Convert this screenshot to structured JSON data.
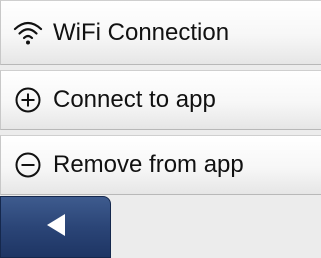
{
  "menu": {
    "items": [
      {
        "label": "WiFi Connection",
        "icon": "wifi-icon"
      },
      {
        "label": "Connect to app",
        "icon": "plus-circle-icon"
      },
      {
        "label": "Remove from app",
        "icon": "minus-circle-icon"
      }
    ]
  },
  "nav": {
    "back_icon": "back-arrow-icon"
  },
  "colors": {
    "background": "#ececec",
    "back_button": "#2b4577",
    "text": "#111111"
  }
}
